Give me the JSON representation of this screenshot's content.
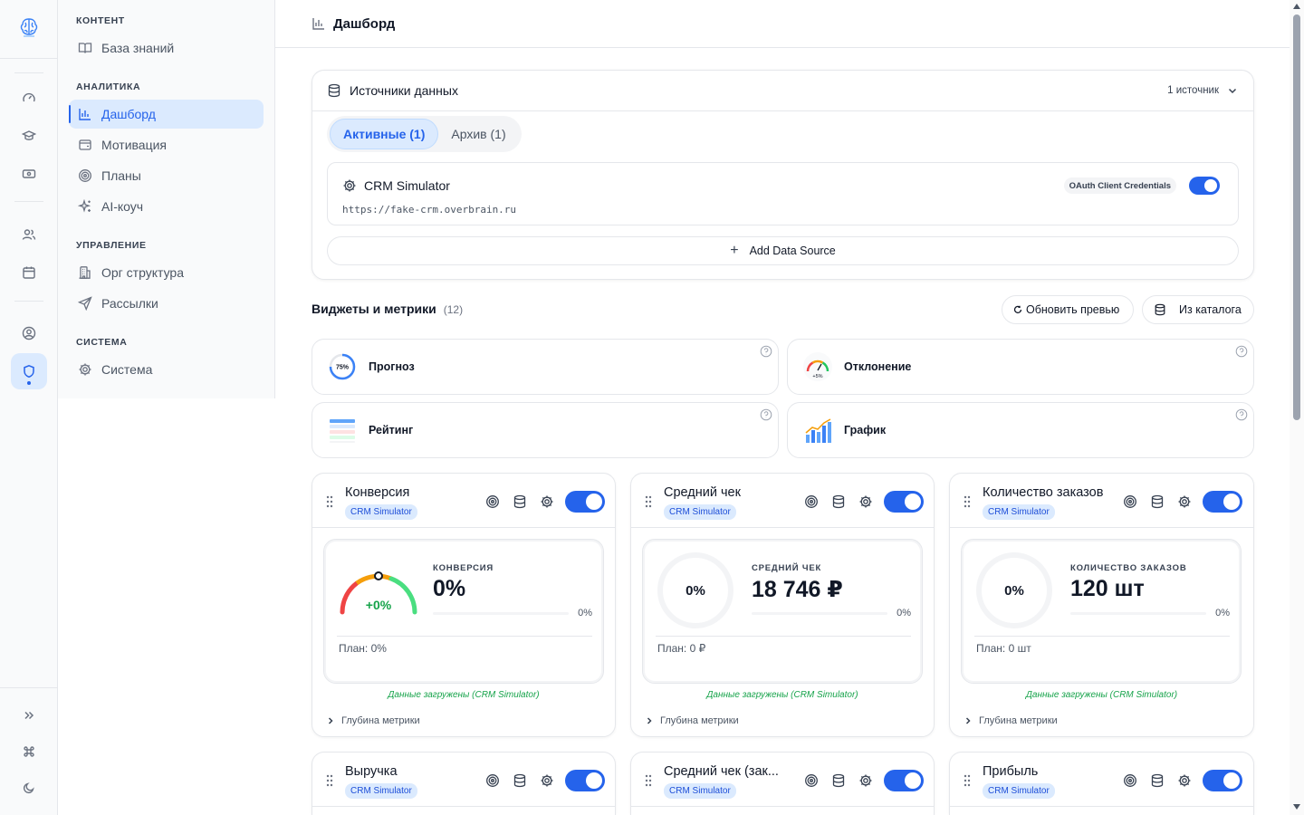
{
  "nav": {
    "sections": [
      {
        "title": "КОНТЕНТ",
        "items": [
          {
            "label": "База знаний"
          }
        ]
      },
      {
        "title": "АНАЛИТИКА",
        "items": [
          {
            "label": "Дашборд"
          },
          {
            "label": "Мотивация"
          },
          {
            "label": "Планы"
          },
          {
            "label": "AI-коуч"
          }
        ]
      },
      {
        "title": "УПРАВЛЕНИЕ",
        "items": [
          {
            "label": "Орг структура"
          },
          {
            "label": "Рассылки"
          }
        ]
      },
      {
        "title": "СИСТЕМА",
        "items": [
          {
            "label": "Система"
          }
        ]
      }
    ],
    "active_item": "Дашборд"
  },
  "header": {
    "title": "Дашборд"
  },
  "data_sources": {
    "title": "Источники данных",
    "count_label": "1 источник",
    "tabs": [
      {
        "label": "Активные (1)",
        "active": true
      },
      {
        "label": "Архив (1)",
        "active": false
      }
    ],
    "source": {
      "name": "CRM Simulator",
      "url": "https://fake-crm.overbrain.ru",
      "auth_badge": "OAuth Client Credentials",
      "enabled": true
    },
    "add_label": "Add Data Source"
  },
  "widgets_section": {
    "title": "Виджеты и метрики",
    "count": "(12)",
    "refresh_label": "Обновить превью",
    "catalog_label": "Из каталога",
    "widget_types": [
      {
        "label": "Прогноз",
        "thumb_text": "75%"
      },
      {
        "label": "Отклонение",
        "thumb_text": "+5%"
      },
      {
        "label": "Рейтинг"
      },
      {
        "label": "График"
      }
    ]
  },
  "widgets": [
    {
      "title": "Конверсия",
      "source_chip": "CRM Simulator",
      "enabled": true,
      "kicker": "КОНВЕРСИЯ",
      "value": "0%",
      "gauge_text": "+0%",
      "progress_pct": "0%",
      "plan": "План: 0%",
      "loaded": "Данные загружены (CRM Simulator)",
      "depth": "Глубина метрики"
    },
    {
      "title": "Средний чек",
      "source_chip": "CRM Simulator",
      "enabled": true,
      "kicker": "СРЕДНИЙ ЧЕК",
      "value": "18 746 ₽",
      "ring_text": "0%",
      "progress_pct": "0%",
      "plan": "План: 0 ₽",
      "loaded": "Данные загружены (CRM Simulator)",
      "depth": "Глубина метрики"
    },
    {
      "title": "Количество заказов",
      "source_chip": "CRM Simulator",
      "enabled": true,
      "kicker": "КОЛИЧЕСТВО ЗАКАЗОВ",
      "value": "120 шт",
      "ring_text": "0%",
      "progress_pct": "0%",
      "plan": "План: 0 шт",
      "loaded": "Данные загружены (CRM Simulator)",
      "depth": "Глубина метрики"
    },
    {
      "title": "Выручка",
      "source_chip": "CRM Simulator",
      "enabled": true
    },
    {
      "title": "Средний чек (зак...",
      "source_chip": "CRM Simulator",
      "enabled": true
    },
    {
      "title": "Прибыль",
      "source_chip": "CRM Simulator",
      "enabled": true
    }
  ],
  "colors": {
    "accent": "#2563eb",
    "accent_soft": "#dbeafe",
    "success": "#16a34a",
    "gauge_red": "#ef4444",
    "gauge_orange": "#f59e0b",
    "gauge_green": "#22c55e"
  },
  "icons": {
    "rail": [
      "logo-brain-icon",
      "gauge-icon",
      "graduation-cap-icon",
      "banknote-icon",
      "users-icon",
      "calendar-icon",
      "user-circle-icon",
      "shield-icon",
      "chevrons-right-icon",
      "command-icon",
      "moon-icon"
    ]
  }
}
